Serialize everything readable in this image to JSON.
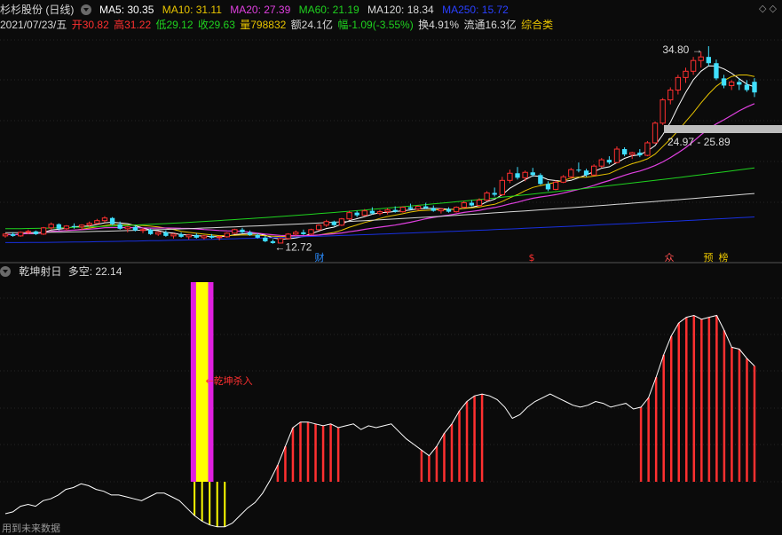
{
  "header": {
    "title": "杉杉股份 (日线)",
    "ma5": "MA5: 30.35",
    "ma10": "MA10: 31.11",
    "ma20": "MA20: 27.39",
    "ma60": "MA60: 21.19",
    "ma120": "MA120: 18.34",
    "ma250": "MA250: 15.72",
    "date": "2021/07/23/五",
    "open": "开30.82",
    "high": "高31.22",
    "low": "低29.12",
    "close": "收29.63",
    "volume": "量798832",
    "amount": "额24.1亿",
    "change": "幅-1.09(-3.55%)",
    "turnover": "换4.91%",
    "float": "流通16.3亿",
    "sector": "综合类",
    "corner_icons": "◇ ◇"
  },
  "indicator": {
    "name": "乾坤射日",
    "value_label": "多空: 22.14"
  },
  "footer": "用到未来数据",
  "colors": {
    "ma5": "#ffffff",
    "ma10": "#e8c400",
    "ma20": "#e040e0",
    "ma60": "#1fd21f",
    "ma120": "#d8d8d8",
    "ma250": "#1830e0",
    "up": "#ff3030",
    "down": "#40e0ff",
    "yellow": "#ffff00",
    "magenta": "#e020e0"
  },
  "chart_data": [
    {
      "type": "candlestick",
      "title": "杉杉股份 (日线)",
      "annotations": {
        "high_label": "34.80",
        "low_label": "12.72",
        "range_label": "24.97 - 25.89",
        "markers": [
          "财",
          "$",
          "众",
          "预",
          "榜"
        ]
      },
      "candles": [
        [
          13.6,
          13.9,
          13.4,
          13.8
        ],
        [
          13.8,
          14.0,
          13.5,
          13.6
        ],
        [
          13.6,
          14.1,
          13.5,
          14.0
        ],
        [
          14.0,
          14.3,
          13.8,
          14.1
        ],
        [
          14.1,
          14.2,
          13.7,
          13.8
        ],
        [
          13.8,
          14.6,
          13.7,
          14.5
        ],
        [
          14.5,
          15.1,
          14.3,
          14.9
        ],
        [
          14.9,
          15.0,
          14.2,
          14.4
        ],
        [
          14.4,
          14.8,
          14.2,
          14.7
        ],
        [
          14.7,
          15.0,
          14.4,
          14.6
        ],
        [
          14.6,
          14.9,
          14.3,
          14.8
        ],
        [
          14.8,
          15.2,
          14.6,
          15.0
        ],
        [
          15.0,
          15.5,
          14.9,
          15.3
        ],
        [
          15.3,
          15.8,
          15.1,
          15.6
        ],
        [
          15.6,
          15.7,
          14.8,
          14.9
        ],
        [
          14.9,
          15.2,
          14.3,
          14.4
        ],
        [
          14.4,
          14.7,
          14.0,
          14.6
        ],
        [
          14.6,
          14.8,
          14.1,
          14.2
        ],
        [
          14.2,
          14.5,
          13.9,
          14.3
        ],
        [
          14.3,
          14.4,
          13.7,
          13.8
        ],
        [
          13.8,
          14.1,
          13.6,
          14.0
        ],
        [
          14.0,
          14.2,
          13.5,
          13.6
        ],
        [
          13.6,
          13.9,
          13.3,
          13.8
        ],
        [
          13.8,
          14.0,
          13.4,
          13.5
        ],
        [
          13.5,
          13.8,
          13.2,
          13.7
        ],
        [
          13.7,
          13.9,
          13.3,
          13.4
        ],
        [
          13.4,
          13.7,
          13.2,
          13.6
        ],
        [
          13.6,
          13.8,
          13.3,
          13.4
        ],
        [
          13.4,
          13.6,
          13.1,
          13.5
        ],
        [
          13.5,
          14.0,
          13.4,
          13.9
        ],
        [
          13.9,
          14.4,
          13.8,
          14.3
        ],
        [
          14.3,
          14.5,
          13.9,
          14.0
        ],
        [
          14.0,
          14.2,
          13.6,
          13.7
        ],
        [
          13.7,
          13.9,
          13.3,
          13.4
        ],
        [
          13.4,
          13.6,
          12.9,
          13.0
        ],
        [
          13.0,
          13.2,
          12.72,
          12.8
        ],
        [
          12.8,
          13.4,
          12.75,
          13.3
        ],
        [
          13.3,
          13.9,
          13.2,
          13.8
        ],
        [
          13.8,
          14.2,
          13.6,
          14.0
        ],
        [
          14.0,
          14.3,
          13.7,
          13.8
        ],
        [
          13.8,
          14.4,
          13.7,
          14.3
        ],
        [
          14.3,
          14.9,
          14.2,
          14.8
        ],
        [
          14.8,
          15.4,
          14.6,
          15.2
        ],
        [
          15.2,
          15.3,
          14.7,
          14.8
        ],
        [
          14.8,
          15.6,
          14.7,
          15.5
        ],
        [
          15.5,
          16.4,
          15.4,
          16.2
        ],
        [
          16.2,
          16.4,
          15.7,
          15.9
        ],
        [
          15.9,
          16.6,
          15.8,
          16.4
        ],
        [
          16.4,
          16.8,
          16.0,
          16.1
        ],
        [
          16.1,
          16.5,
          15.9,
          16.3
        ],
        [
          16.3,
          16.7,
          16.0,
          16.5
        ],
        [
          16.5,
          16.9,
          16.2,
          16.3
        ],
        [
          16.3,
          16.9,
          16.2,
          16.8
        ],
        [
          16.8,
          17.2,
          16.5,
          16.6
        ],
        [
          16.6,
          17.0,
          16.4,
          16.9
        ],
        [
          16.9,
          17.3,
          16.6,
          16.7
        ],
        [
          16.7,
          17.0,
          16.3,
          16.4
        ],
        [
          16.4,
          16.7,
          16.1,
          16.6
        ],
        [
          16.6,
          16.8,
          16.2,
          16.3
        ],
        [
          16.3,
          16.9,
          16.2,
          16.8
        ],
        [
          16.8,
          17.5,
          16.7,
          17.3
        ],
        [
          17.3,
          17.6,
          16.9,
          17.0
        ],
        [
          17.0,
          17.8,
          16.9,
          17.6
        ],
        [
          17.6,
          18.6,
          17.5,
          18.4
        ],
        [
          18.4,
          19.0,
          18.0,
          18.2
        ],
        [
          18.2,
          20.2,
          18.1,
          19.8
        ],
        [
          19.8,
          21.0,
          19.5,
          20.6
        ],
        [
          20.6,
          21.3,
          19.9,
          20.1
        ],
        [
          20.1,
          20.9,
          19.7,
          20.7
        ],
        [
          20.7,
          21.2,
          20.2,
          20.4
        ],
        [
          20.4,
          20.6,
          19.3,
          19.4
        ],
        [
          19.4,
          19.7,
          18.6,
          18.8
        ],
        [
          18.8,
          19.8,
          18.7,
          19.6
        ],
        [
          19.6,
          20.4,
          19.5,
          20.2
        ],
        [
          20.2,
          21.2,
          20.0,
          21.0
        ],
        [
          21.0,
          21.8,
          20.7,
          20.9
        ],
        [
          20.9,
          21.1,
          20.2,
          20.4
        ],
        [
          20.4,
          21.6,
          20.3,
          21.4
        ],
        [
          21.4,
          22.3,
          21.2,
          22.1
        ],
        [
          22.1,
          22.5,
          21.6,
          21.8
        ],
        [
          21.8,
          23.6,
          21.7,
          23.3
        ],
        [
          23.3,
          23.5,
          22.5,
          22.7
        ],
        [
          22.7,
          23.0,
          22.2,
          22.9
        ],
        [
          22.9,
          23.3,
          22.4,
          22.6
        ],
        [
          22.6,
          24.2,
          22.5,
          24.0
        ],
        [
          24.0,
          26.4,
          23.9,
          26.2
        ],
        [
          26.2,
          29.0,
          26.0,
          28.8
        ],
        [
          28.8,
          30.2,
          28.3,
          29.9
        ],
        [
          29.9,
          31.6,
          29.4,
          31.3
        ],
        [
          31.3,
          32.4,
          30.7,
          32.0
        ],
        [
          32.0,
          33.6,
          31.6,
          33.2
        ],
        [
          33.2,
          34.2,
          32.4,
          33.6
        ],
        [
          33.6,
          34.8,
          32.6,
          32.9
        ],
        [
          32.9,
          33.3,
          31.0,
          31.2
        ],
        [
          31.2,
          31.6,
          30.1,
          30.4
        ],
        [
          30.4,
          31.0,
          29.9,
          30.8
        ],
        [
          30.8,
          31.22,
          29.9,
          30.5
        ],
        [
          30.5,
          31.0,
          29.7,
          29.9
        ],
        [
          30.82,
          31.22,
          29.12,
          29.63
        ]
      ],
      "ma_end_values": {
        "MA5": 30.35,
        "MA10": 31.11,
        "MA20": 27.39,
        "MA60": 21.19,
        "MA120": 18.34,
        "MA250": 15.72
      },
      "ma_start_values": {
        "MA60": 14.4,
        "MA120": 13.95,
        "MA250": 12.85
      }
    },
    {
      "type": "line",
      "title": "乾坤射日",
      "annotation": "←乾坤杀入",
      "value_label": "多空: 22.14",
      "values": [
        9,
        10,
        13,
        14,
        13,
        16,
        17,
        19,
        22,
        23,
        25,
        24,
        22,
        21,
        19,
        19,
        18,
        17,
        16,
        18,
        20,
        20,
        18,
        16,
        12,
        8,
        5,
        3,
        2,
        2,
        4,
        8,
        12,
        15,
        20,
        27,
        35,
        45,
        55,
        58,
        58,
        57,
        56,
        57,
        55,
        56,
        57,
        54,
        56,
        55,
        56,
        57,
        53,
        49,
        46,
        43,
        40,
        45,
        52,
        57,
        64,
        69,
        72,
        73,
        72,
        70,
        66,
        60,
        62,
        66,
        69,
        71,
        73,
        71,
        69,
        67,
        66,
        67,
        69,
        68,
        66,
        67,
        68,
        65,
        66,
        71,
        82,
        94,
        104,
        111,
        114,
        115,
        113,
        114,
        115,
        107,
        98,
        97,
        92,
        88
      ],
      "red_ranges": [
        [
          36,
          44
        ],
        [
          55,
          63
        ],
        [
          84,
          99
        ]
      ],
      "yellow_range": [
        25,
        29
      ],
      "signal_index": 25
    }
  ]
}
